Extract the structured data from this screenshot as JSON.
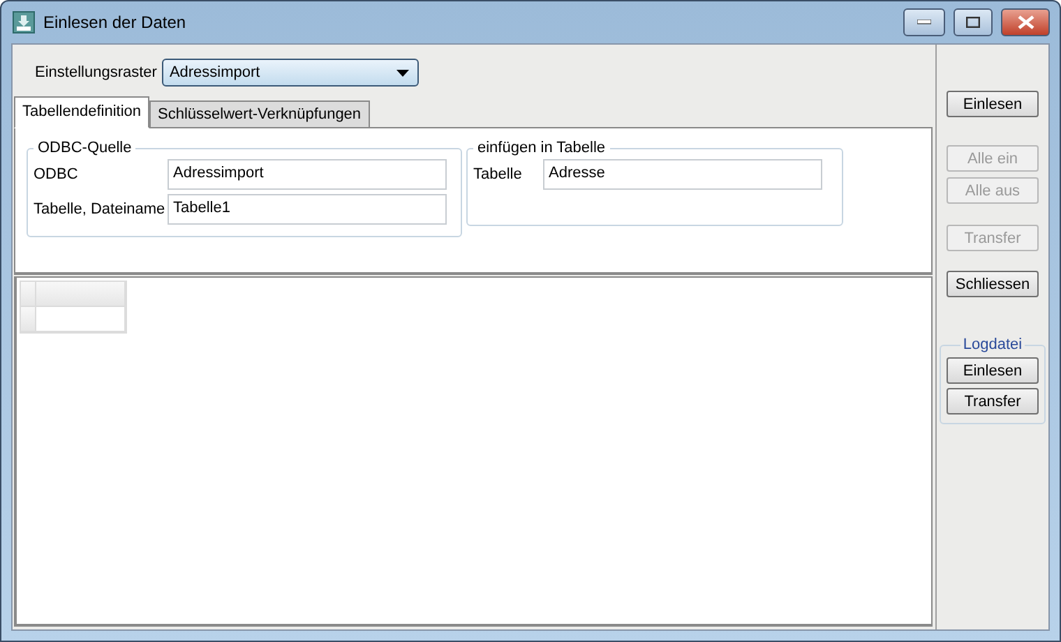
{
  "window": {
    "title": "Einlesen der Daten"
  },
  "settings": {
    "label": "Einstellungsraster",
    "value": "Adressimport"
  },
  "tabs": [
    {
      "label": "Tabellendefinition",
      "selected": true
    },
    {
      "label": "Schlüsselwert-Verknüpfungen",
      "selected": false
    }
  ],
  "groups": [
    {
      "title": "ODBC-Quelle",
      "fields": [
        {
          "label": "ODBC",
          "value": "Adressimport"
        },
        {
          "label": "Tabelle, Dateiname",
          "value": "Tabelle1"
        }
      ]
    },
    {
      "title": "einfügen in Tabelle",
      "fields": [
        {
          "label": "Tabelle",
          "value": "Adresse"
        }
      ]
    }
  ],
  "side_buttons": [
    {
      "label": "Einlesen",
      "disabled": false
    },
    {
      "label": "Alle ein",
      "disabled": true
    },
    {
      "label": "Alle aus",
      "disabled": true
    },
    {
      "label": "Transfer",
      "disabled": true
    },
    {
      "label": "Schliessen",
      "disabled": false
    }
  ],
  "log_group": {
    "title": "Logdatei",
    "buttons": [
      {
        "label": "Einlesen",
        "disabled": false
      },
      {
        "label": "Transfer",
        "disabled": false
      }
    ]
  }
}
